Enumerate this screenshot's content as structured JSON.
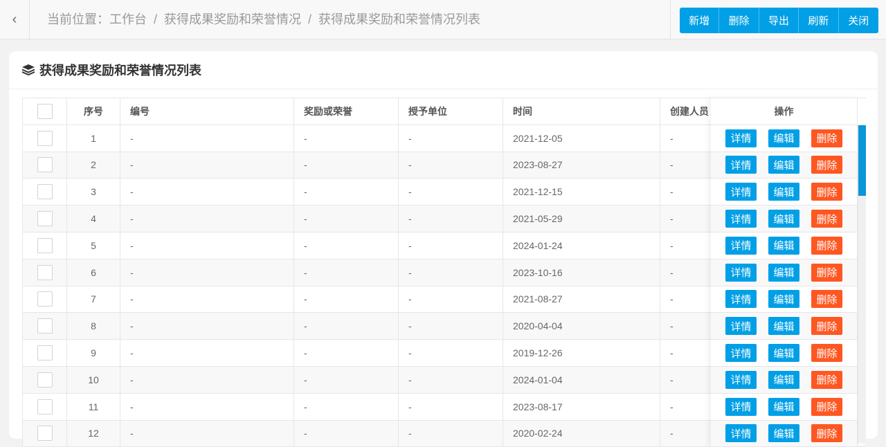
{
  "breadcrumb": {
    "prefix": "当前位置：",
    "items": [
      "工作台",
      "获得成果奖励和荣誉情况",
      "获得成果奖励和荣誉情况列表"
    ]
  },
  "toolbar": [
    "新增",
    "删除",
    "导出",
    "刷新",
    "关闭"
  ],
  "card_title": "获得成果奖励和荣誉情况列表",
  "columns": [
    "序号",
    "编号",
    "奖励或荣誉",
    "授予单位",
    "时间",
    "创建人员",
    "操作"
  ],
  "row_actions": {
    "detail": "详情",
    "edit": "编辑",
    "delete": "删除"
  },
  "rows": [
    {
      "no": "1",
      "code": "-",
      "award": "-",
      "unit": "-",
      "date": "2021-12-05",
      "creator": "-"
    },
    {
      "no": "2",
      "code": "-",
      "award": "-",
      "unit": "-",
      "date": "2023-08-27",
      "creator": "-"
    },
    {
      "no": "3",
      "code": "-",
      "award": "-",
      "unit": "-",
      "date": "2021-12-15",
      "creator": "-"
    },
    {
      "no": "4",
      "code": "-",
      "award": "-",
      "unit": "-",
      "date": "2021-05-29",
      "creator": "-"
    },
    {
      "no": "5",
      "code": "-",
      "award": "-",
      "unit": "-",
      "date": "2024-01-24",
      "creator": "-"
    },
    {
      "no": "6",
      "code": "-",
      "award": "-",
      "unit": "-",
      "date": "2023-10-16",
      "creator": "-"
    },
    {
      "no": "7",
      "code": "-",
      "award": "-",
      "unit": "-",
      "date": "2021-08-27",
      "creator": "-"
    },
    {
      "no": "8",
      "code": "-",
      "award": "-",
      "unit": "-",
      "date": "2020-04-04",
      "creator": "-"
    },
    {
      "no": "9",
      "code": "-",
      "award": "-",
      "unit": "-",
      "date": "2019-12-26",
      "creator": "-"
    },
    {
      "no": "10",
      "code": "-",
      "award": "-",
      "unit": "-",
      "date": "2024-01-04",
      "creator": "-"
    },
    {
      "no": "11",
      "code": "-",
      "award": "-",
      "unit": "-",
      "date": "2023-08-17",
      "creator": "-"
    },
    {
      "no": "12",
      "code": "-",
      "award": "-",
      "unit": "-",
      "date": "2020-02-24",
      "creator": "-"
    }
  ]
}
